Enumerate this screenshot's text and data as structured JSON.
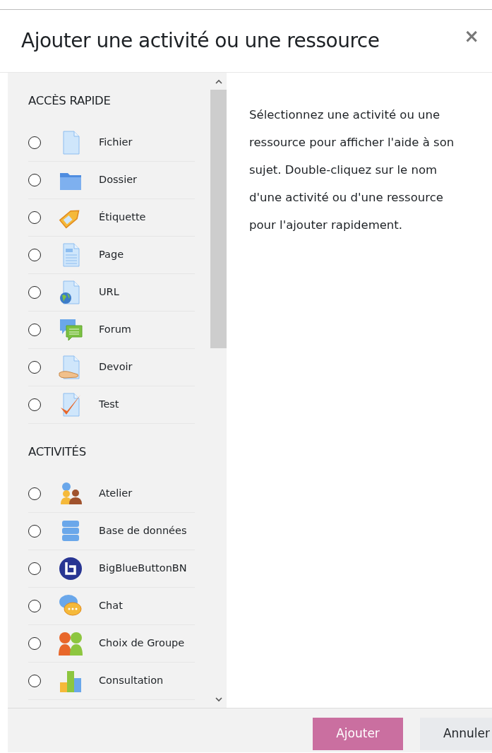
{
  "dialog": {
    "title": "Ajouter une activité ou une ressource",
    "close": "×"
  },
  "sections": [
    {
      "title": "ACCÈS RAPIDE",
      "items": [
        {
          "kind": "file",
          "label": "Fichier",
          "selected": false
        },
        {
          "kind": "folder",
          "label": "Dossier",
          "selected": false
        },
        {
          "kind": "tag",
          "label": "Étiquette",
          "selected": false
        },
        {
          "kind": "page",
          "label": "Page",
          "selected": false
        },
        {
          "kind": "url",
          "label": "URL",
          "selected": false
        },
        {
          "kind": "forum",
          "label": "Forum",
          "selected": false
        },
        {
          "kind": "assign",
          "label": "Devoir",
          "selected": false
        },
        {
          "kind": "quiz",
          "label": "Test",
          "selected": false
        }
      ]
    },
    {
      "title": "ACTIVITÉS",
      "items": [
        {
          "kind": "workshop",
          "label": "Atelier",
          "selected": false
        },
        {
          "kind": "database",
          "label": "Base de données",
          "selected": false
        },
        {
          "kind": "bbb",
          "label": "BigBlueButtonBN",
          "selected": false
        },
        {
          "kind": "chat",
          "label": "Chat",
          "selected": false
        },
        {
          "kind": "groups",
          "label": "Choix de Groupe",
          "selected": false
        },
        {
          "kind": "chart",
          "label": "Consultation",
          "selected": false
        }
      ]
    }
  ],
  "help": "Sélectionnez une activité ou une ressource pour afficher l'aide à son sujet. Double-cliquez sur le nom d'une activité ou d'une ressource pour l'ajouter rapidement.",
  "buttons": [
    {
      "kind": "primary",
      "label": "Ajouter"
    },
    {
      "kind": "secondary",
      "label": "Annuler"
    }
  ]
}
